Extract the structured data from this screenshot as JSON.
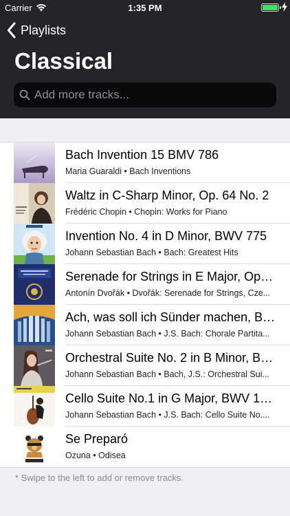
{
  "status": {
    "carrier": "Carrier",
    "time": "1:35 PM",
    "battery_level": 1.0
  },
  "nav": {
    "back_label": "Playlists"
  },
  "playlist": {
    "title": "Classical"
  },
  "search": {
    "placeholder": "Add more tracks..."
  },
  "tracks": [
    {
      "title": "Bach Invention 15 BMV 786",
      "subtitle": "Maria Guaraldi • Bach Inventions",
      "art": "piano-art"
    },
    {
      "title": "Waltz in C-Sharp Minor, Op. 64 No. 2",
      "subtitle": "Frédéric Chopin • Chopin: Works for Piano",
      "art": "pianist-portrait-art"
    },
    {
      "title": "Invention No. 4 in D Minor, BWV 775",
      "subtitle": "Johann Sebastian Bach • Bach: Greatest Hits",
      "art": "bach-caricature-art"
    },
    {
      "title": "Serenade for Strings in E Major, Op. 2...",
      "subtitle": "Antonín Dvořák • Dvořák: Serenade for Strings, Cze...",
      "art": "blue-cover-art"
    },
    {
      "title": "Ach, was soll ich Sünder machen, BW...",
      "subtitle": "Johann Sebastian Bach • J.S. Bach: Chorale Partita...",
      "art": "organ-pipes-art"
    },
    {
      "title": "Orchestral Suite No. 2 in B Minor, BW...",
      "subtitle": "Johann Sebastian Bach • Bach, J.S.: Orchestral Sui...",
      "art": "flutist-portrait-art"
    },
    {
      "title": "Cello Suite No.1 in G Major, BWV 100...",
      "subtitle": "Johann Sebastian Bach • J.S. Bach: Cello Suite No....",
      "art": "cellist-art"
    },
    {
      "title": "Se Preparó",
      "subtitle": "Ozuna • Odisea",
      "art": "bear-logo-art"
    }
  ],
  "footer": {
    "hint": "* Swipe to the left to add or remove tracks."
  },
  "colors": {
    "header_bg": "#252527",
    "battery": "#4cd964",
    "background": "#efeff4"
  }
}
